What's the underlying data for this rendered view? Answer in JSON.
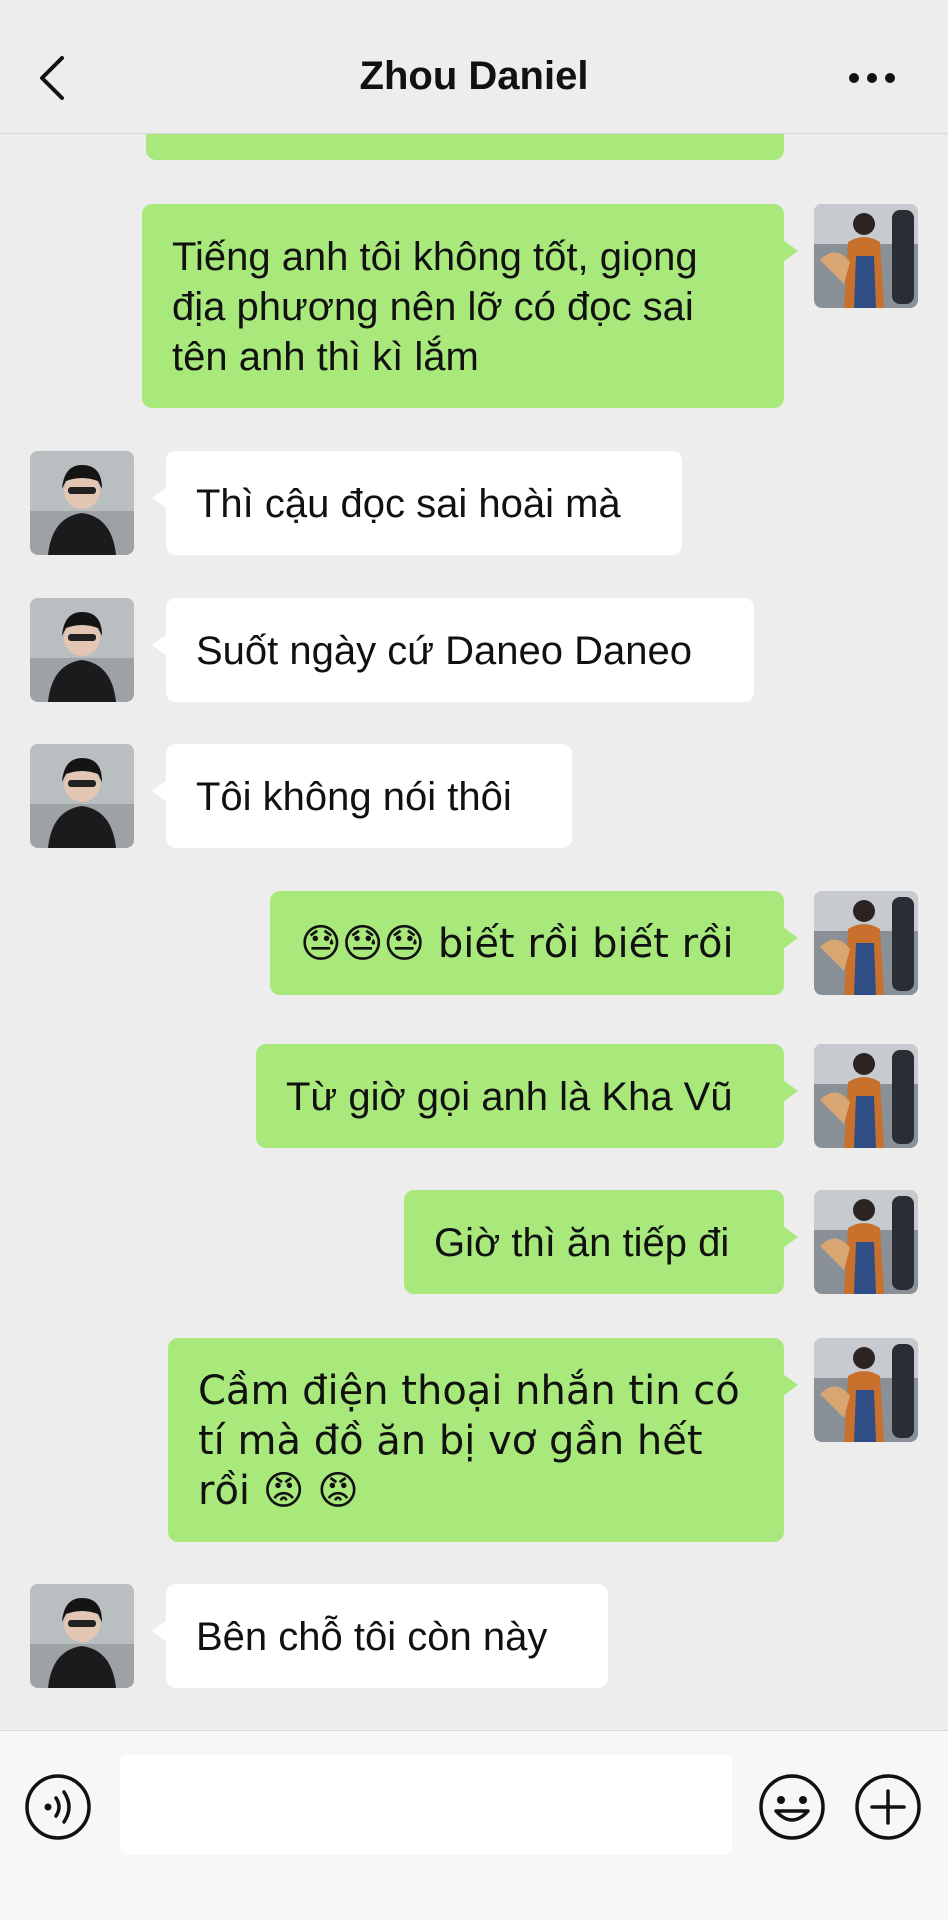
{
  "header": {
    "title": "Zhou Daniel",
    "back_icon": "chevron-left-icon",
    "more_icon": "more-dots-icon"
  },
  "messages": [
    {
      "sender": "me",
      "text": "Tiếng anh tôi không tốt, giọng địa phương nên lỡ có đọc sai tên anh thì kì lắm"
    },
    {
      "sender": "them",
      "text": "Thì cậu đọc sai hoài mà"
    },
    {
      "sender": "them",
      "text": "Suốt ngày cứ Daneo Daneo"
    },
    {
      "sender": "them",
      "text": "Tôi không nói thôi"
    },
    {
      "sender": "me",
      "text": "😓😓😓 biết rồi biết rồi"
    },
    {
      "sender": "me",
      "text": "Từ giờ gọi anh là Kha Vũ"
    },
    {
      "sender": "me",
      "text": "Giờ thì ăn tiếp đi"
    },
    {
      "sender": "me",
      "text": "Cầm điện thoại nhắn tin có tí mà đồ ăn bị vơ gần hết rồi 😡 😡"
    },
    {
      "sender": "them",
      "text": "Bên chỗ tôi còn này"
    }
  ],
  "input": {
    "value": "",
    "placeholder": ""
  },
  "toolbar": {
    "voice_icon": "voice-icon",
    "emoji_icon": "emoji-icon",
    "plus_icon": "plus-icon"
  },
  "colors": {
    "my_bubble": "#a9e97b",
    "their_bubble": "#ffffff",
    "background": "#ededed"
  }
}
